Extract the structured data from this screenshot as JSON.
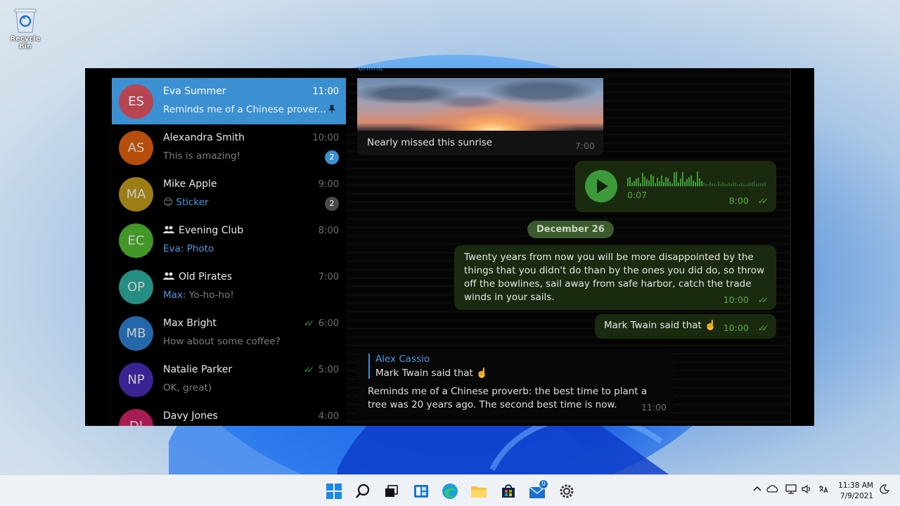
{
  "desktop": {
    "recycle_bin_label": "Recycle Bin"
  },
  "chat_list": [
    {
      "initials": "ES",
      "name": "Eva Summer",
      "time": "11:00",
      "preview": "Reminds me of a Chinese prover...",
      "color": "#e53935",
      "active": true,
      "pinned": true
    },
    {
      "initials": "AS",
      "name": "Alexandra Smith",
      "time": "10:00",
      "preview": "This is amazing!",
      "color": "#e8650f",
      "badge": "2"
    },
    {
      "initials": "MA",
      "name": "Mike Apple",
      "time": "9:00",
      "preview_emoji": "😊",
      "preview": "Sticker",
      "color": "#c9a21b",
      "badge": "2",
      "badge_muted": true
    },
    {
      "initials": "EC",
      "name": "Evening Club",
      "time": "8:00",
      "preview_sender": "Eva:",
      "preview": "Photo",
      "color": "#55c233",
      "group": true
    },
    {
      "initials": "OP",
      "name": "Old Pirates",
      "time": "7:00",
      "preview_sender": "Max:",
      "preview": "Yo-ho-ho!",
      "color": "#2fb7a7",
      "group": true
    },
    {
      "initials": "MB",
      "name": "Max Bright",
      "time": "6:00",
      "preview": "How about some coffee?",
      "color": "#2f86d9",
      "read": true
    },
    {
      "initials": "NP",
      "name": "Natalie Parker",
      "time": "5:00",
      "preview": "OK, great)",
      "color": "#4b2fbd",
      "read": true
    },
    {
      "initials": "DJ",
      "name": "Davy Jones",
      "time": "4:00",
      "preview": "",
      "color": "#d8246b"
    }
  ],
  "conversation": {
    "status": "online",
    "photo_message": {
      "caption": "Nearly missed this sunrise",
      "time": "7:00"
    },
    "voice_message": {
      "duration": "0:07",
      "time": "8:00"
    },
    "date_separator": "December 26",
    "quote_message": {
      "text": "Twenty years from now you will be more disappointed by the things that you didn't do than by the ones you did do, so throw off the bowlines, sail away from safe harbor, catch the trade winds in your sails.",
      "time": "10:00"
    },
    "twain_message": {
      "text": "Mark Twain said that ☝️",
      "time": "10:00"
    },
    "reply_message": {
      "reply_author": "Alex Cassio",
      "reply_text": "Mark Twain said that ☝️",
      "text": "Reminds me of a Chinese proverb: the best time to plant a tree was 20 years ago. The second best time is now.",
      "time": "11:00"
    }
  },
  "taskbar": {
    "icons": [
      "windows-start-icon",
      "search-icon",
      "task-view-icon",
      "widgets-icon",
      "edge-icon",
      "file-explorer-icon",
      "store-icon",
      "mail-icon",
      "settings-icon"
    ],
    "mail_badge": "0",
    "clock_time": "11:38 AM",
    "clock_date": "7/9/2021"
  }
}
